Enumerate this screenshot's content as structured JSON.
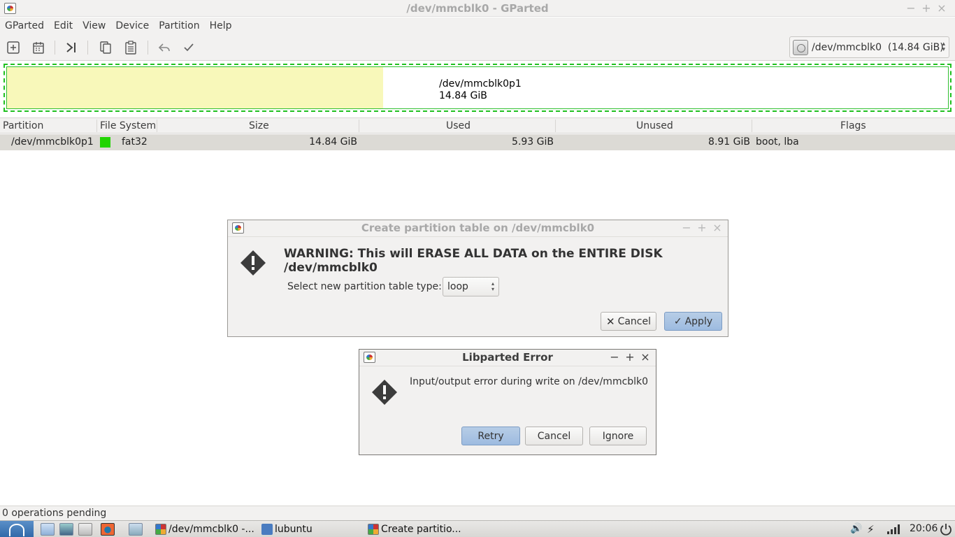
{
  "window": {
    "title": "/dev/mmcblk0 - GParted",
    "controls": [
      "−",
      "+",
      "×"
    ]
  },
  "menubar": {
    "items": [
      "GParted",
      "Edit",
      "View",
      "Device",
      "Partition",
      "Help"
    ]
  },
  "toolbar": {
    "icons": [
      "new-icon",
      "delete-icon",
      "resize-move-icon",
      "copy-icon",
      "paste-icon",
      "undo-icon",
      "apply-icon"
    ],
    "device_selector": "/dev/mmcblk0  (14.84 GiB)"
  },
  "diskmap": {
    "partition_name": "/dev/mmcblk0p1",
    "partition_size": "14.84 GiB",
    "used_fraction": 0.4,
    "colors": {
      "used": "#f8f8ba",
      "border": "#20c020"
    }
  },
  "table": {
    "columns": [
      "Partition",
      "File System",
      "Size",
      "Used",
      "Unused",
      "Flags"
    ],
    "rows": [
      {
        "partition": "/dev/mmcblk0p1",
        "filesystem": "fat32",
        "fs_color": "#21d400",
        "size": "14.84 GiB",
        "used": "5.93 GiB",
        "unused": "8.91 GiB",
        "flags": "boot, lba"
      }
    ]
  },
  "dialog_create": {
    "title": "Create partition table on /dev/mmcblk0",
    "controls": [
      "−",
      "+",
      "×"
    ],
    "warning": "WARNING:  This will ERASE ALL DATA on the ENTIRE DISK /dev/mmcblk0",
    "select_label": "Select new partition table type:",
    "select_value": "loop",
    "cancel_label": "Cancel",
    "apply_label": "Apply"
  },
  "dialog_error": {
    "title": "Libparted Error",
    "controls": [
      "−",
      "+",
      "×"
    ],
    "message": "Input/output error during write on /dev/mmcblk0",
    "retry_label": "Retry",
    "cancel_label": "Cancel",
    "ignore_label": "Ignore"
  },
  "status": {
    "text": "0 operations pending"
  },
  "taskbar": {
    "tasks": [
      "/dev/mmcblk0 -...",
      "lubuntu",
      "Create partitio..."
    ],
    "clock": "20:06"
  }
}
